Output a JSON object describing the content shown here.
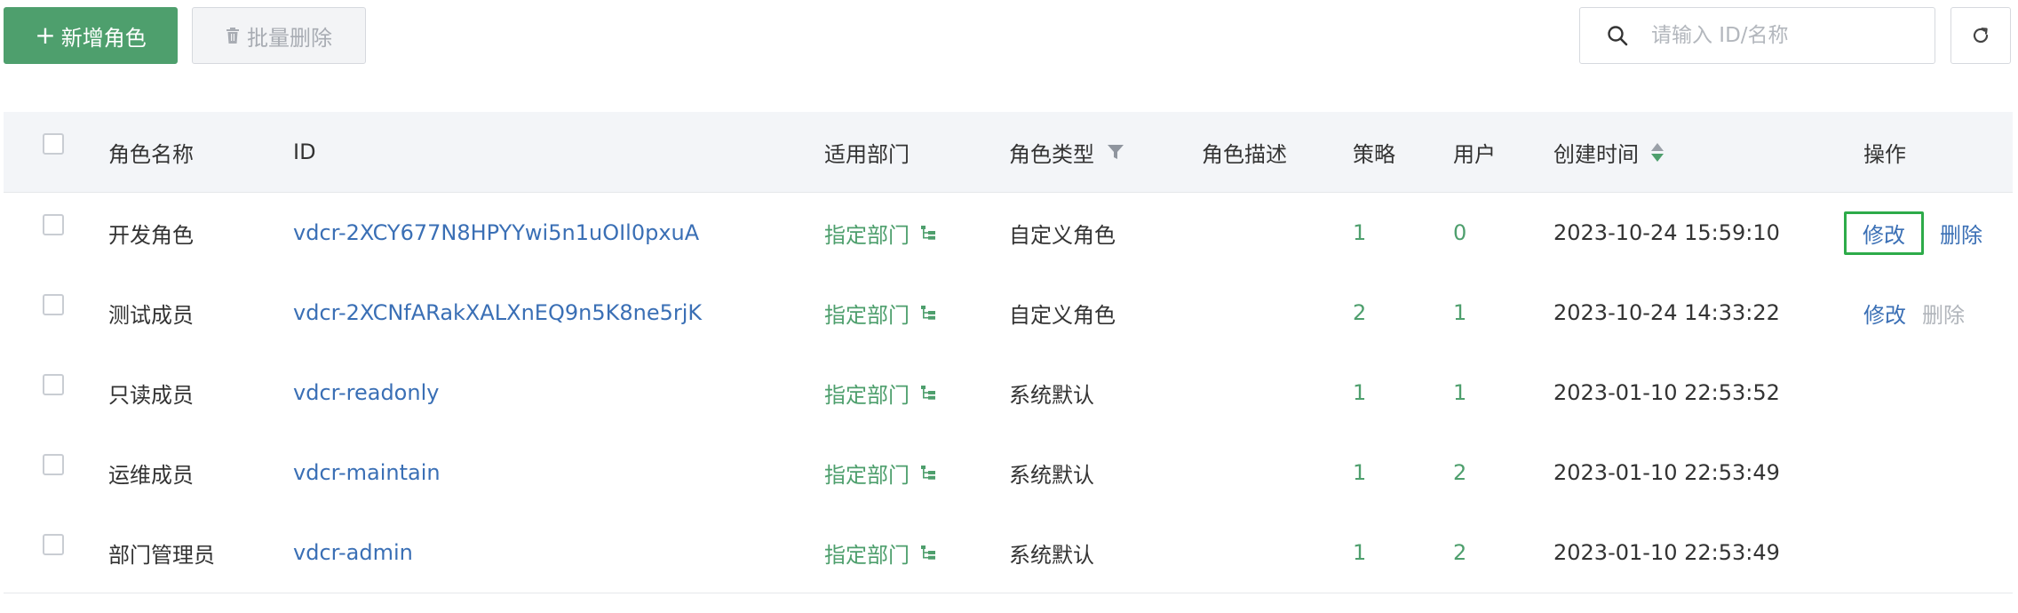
{
  "toolbar": {
    "add_label": "新增角色",
    "add_icon": "plus-icon",
    "batch_delete_label": "批量删除",
    "batch_delete_icon": "trash-icon",
    "search_placeholder": "请输入 ID/名称",
    "search_value": "",
    "refresh_icon": "refresh-icon"
  },
  "colors": {
    "primary": "#4e9f6d",
    "link": "#3a6fb5",
    "disabled": "#b1b5bb",
    "focus_outline": "#2dab49"
  },
  "table": {
    "headers": {
      "name": "角色名称",
      "id": "ID",
      "dept": "适用部门",
      "type": "角色类型",
      "desc": "角色描述",
      "policy": "策略",
      "users": "用户",
      "created": "创建时间",
      "ops": "操作"
    },
    "rows": [
      {
        "name": "开发角色",
        "id": "vdcr-2XCY677N8HPYYwi5n1uOIl0pxuA",
        "dept": "指定部门",
        "type": "自定义角色",
        "desc": "",
        "policy": "1",
        "users": "0",
        "created": "2023-10-24 15:59:10",
        "edit": "修改",
        "delete": "删除"
      },
      {
        "name": "测试成员",
        "id": "vdcr-2XCNfARakXALXnEQ9n5K8ne5rjK",
        "dept": "指定部门",
        "type": "自定义角色",
        "desc": "",
        "policy": "2",
        "users": "1",
        "created": "2023-10-24 14:33:22",
        "edit": "修改",
        "delete": "删除"
      },
      {
        "name": "只读成员",
        "id": "vdcr-readonly",
        "dept": "指定部门",
        "type": "系统默认",
        "desc": "",
        "policy": "1",
        "users": "1",
        "created": "2023-01-10 22:53:52",
        "edit": "",
        "delete": ""
      },
      {
        "name": "运维成员",
        "id": "vdcr-maintain",
        "dept": "指定部门",
        "type": "系统默认",
        "desc": "",
        "policy": "1",
        "users": "2",
        "created": "2023-01-10 22:53:49",
        "edit": "",
        "delete": ""
      },
      {
        "name": "部门管理员",
        "id": "vdcr-admin",
        "dept": "指定部门",
        "type": "系统默认",
        "desc": "",
        "policy": "1",
        "users": "2",
        "created": "2023-01-10 22:53:49",
        "edit": "",
        "delete": ""
      }
    ]
  }
}
